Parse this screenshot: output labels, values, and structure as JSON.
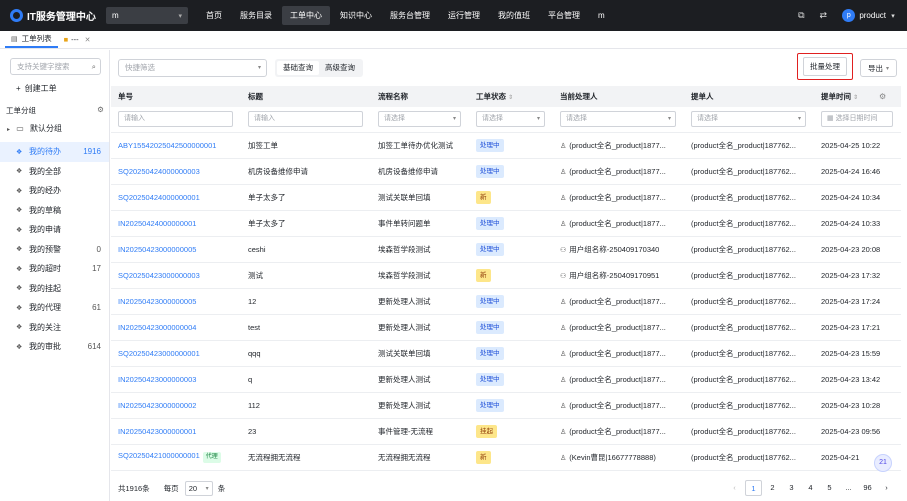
{
  "app": {
    "title": "IT服务管理中心",
    "tenant": "m"
  },
  "nav": [
    "首页",
    "服务目录",
    "工单中心",
    "知识中心",
    "服务台管理",
    "运行管理",
    "我的值班",
    "平台管理",
    "m"
  ],
  "user": {
    "avatar_letter": "p",
    "name": "product"
  },
  "tabs": [
    {
      "label": "工单列表"
    },
    {
      "label": "---"
    }
  ],
  "sidebar": {
    "search_placeholder": "支持关键字搜索",
    "create_label": "创建工单",
    "group_title": "工单分组",
    "root_label": "默认分组",
    "items": [
      {
        "label": "我的待办",
        "count": "1916"
      },
      {
        "label": "我的全部",
        "count": ""
      },
      {
        "label": "我的经办",
        "count": ""
      },
      {
        "label": "我的草稿",
        "count": ""
      },
      {
        "label": "我的申请",
        "count": ""
      },
      {
        "label": "我的预警",
        "count": "0"
      },
      {
        "label": "我的超时",
        "count": "17"
      },
      {
        "label": "我的挂起",
        "count": ""
      },
      {
        "label": "我的代理",
        "count": "61"
      },
      {
        "label": "我的关注",
        "count": ""
      },
      {
        "label": "我的审批",
        "count": "614"
      }
    ]
  },
  "toolbar": {
    "quick_filter_placeholder": "快捷筛选",
    "query_tabs": [
      "基础查询",
      "高级查询"
    ],
    "batch_label": "批量处理",
    "export_label": "导出"
  },
  "table": {
    "columns": [
      "单号",
      "标题",
      "流程名称",
      "工单状态",
      "当前处理人",
      "提单人",
      "提单时间"
    ],
    "filters": [
      "请输入",
      "请输入",
      "请选择",
      "请选择",
      "请选择",
      "请选择",
      "选择日期时间"
    ],
    "rows": [
      {
        "id": "ABY15542025042500000001",
        "title": "加签工单",
        "flow": "加签工单待办优化测试",
        "status": "处理中",
        "stype": "proc",
        "handler": "(product全名_product|1877...",
        "submitter": "(product全名_product|187762...",
        "time": "2025-04-25 10:22",
        "proxy": ""
      },
      {
        "id": "SQ20250424000000003",
        "title": "机房设备维修申请",
        "flow": "机房设备维修申请",
        "status": "处理中",
        "stype": "proc",
        "handler": "(product全名_product|1877...",
        "submitter": "(product全名_product|187762...",
        "time": "2025-04-24 16:46",
        "proxy": ""
      },
      {
        "id": "SQ20250424000000001",
        "title": "单子太多了",
        "flow": "测试关联单回填",
        "status": "新",
        "stype": "new",
        "handler": "(product全名_product|1877...",
        "submitter": "(product全名_product|187762...",
        "time": "2025-04-24 10:34",
        "proxy": ""
      },
      {
        "id": "IN20250424000000001",
        "title": "单子太多了",
        "flow": "事件单转问题单",
        "status": "处理中",
        "stype": "proc",
        "handler": "(product全名_product|1877...",
        "submitter": "(product全名_product|187762...",
        "time": "2025-04-24 10:33",
        "proxy": ""
      },
      {
        "id": "IN20250423000000005",
        "title": "ceshi",
        "flow": "埃森哲学段测试",
        "status": "处理中",
        "stype": "proc",
        "handler": "用户组名称-250409170340",
        "submitter": "(product全名_product|187762...",
        "time": "2025-04-23 20:08",
        "proxy": ""
      },
      {
        "id": "SQ20250423000000003",
        "title": "测试",
        "flow": "埃森哲学段测试",
        "status": "新",
        "stype": "new",
        "handler": "用户组名称-250409170951",
        "submitter": "(product全名_product|187762...",
        "time": "2025-04-23 17:32",
        "proxy": ""
      },
      {
        "id": "IN20250423000000005",
        "title": "12",
        "flow": "更新处理人测试",
        "status": "处理中",
        "stype": "proc",
        "handler": "(product全名_product|1877...",
        "submitter": "(product全名_product|187762...",
        "time": "2025-04-23 17:24",
        "proxy": ""
      },
      {
        "id": "IN20250423000000004",
        "title": "test",
        "flow": "更新处理人测试",
        "status": "处理中",
        "stype": "proc",
        "handler": "(product全名_product|1877...",
        "submitter": "(product全名_product|187762...",
        "time": "2025-04-23 17:21",
        "proxy": ""
      },
      {
        "id": "SQ20250423000000001",
        "title": "qqq",
        "flow": "测试关联单回填",
        "status": "处理中",
        "stype": "proc",
        "handler": "(product全名_product|1877...",
        "submitter": "(product全名_product|187762...",
        "time": "2025-04-23 15:59",
        "proxy": ""
      },
      {
        "id": "IN20250423000000003",
        "title": "q",
        "flow": "更新处理人测试",
        "status": "处理中",
        "stype": "proc",
        "handler": "(product全名_product|1877...",
        "submitter": "(product全名_product|187762...",
        "time": "2025-04-23 13:42",
        "proxy": ""
      },
      {
        "id": "IN20250423000000002",
        "title": "112",
        "flow": "更新处理人测试",
        "status": "处理中",
        "stype": "proc",
        "handler": "(product全名_product|1877...",
        "submitter": "(product全名_product|187762...",
        "time": "2025-04-23 10:28",
        "proxy": ""
      },
      {
        "id": "IN20250423000000001",
        "title": "23",
        "flow": "事件管理-无流程",
        "status": "挂起",
        "stype": "hold",
        "handler": "(product全名_product|1877...",
        "submitter": "(product全名_product|187762...",
        "time": "2025-04-23 09:56",
        "proxy": ""
      },
      {
        "id": "SQ20250421000000001",
        "title": "无流程拥无流程",
        "flow": "无流程拥无流程",
        "status": "新",
        "stype": "new",
        "handler": "(Kevin曹昆|16677778888)",
        "submitter": "(product全名_product|187762...",
        "time": "2025-04-21",
        "proxy": "代理"
      }
    ]
  },
  "pager": {
    "total": "共1916条",
    "per_label": "每页",
    "size": "20",
    "unit": "条",
    "pages": [
      "1",
      "2",
      "3",
      "4",
      "5",
      "...",
      "96"
    ],
    "prev": "‹",
    "next": "›"
  }
}
